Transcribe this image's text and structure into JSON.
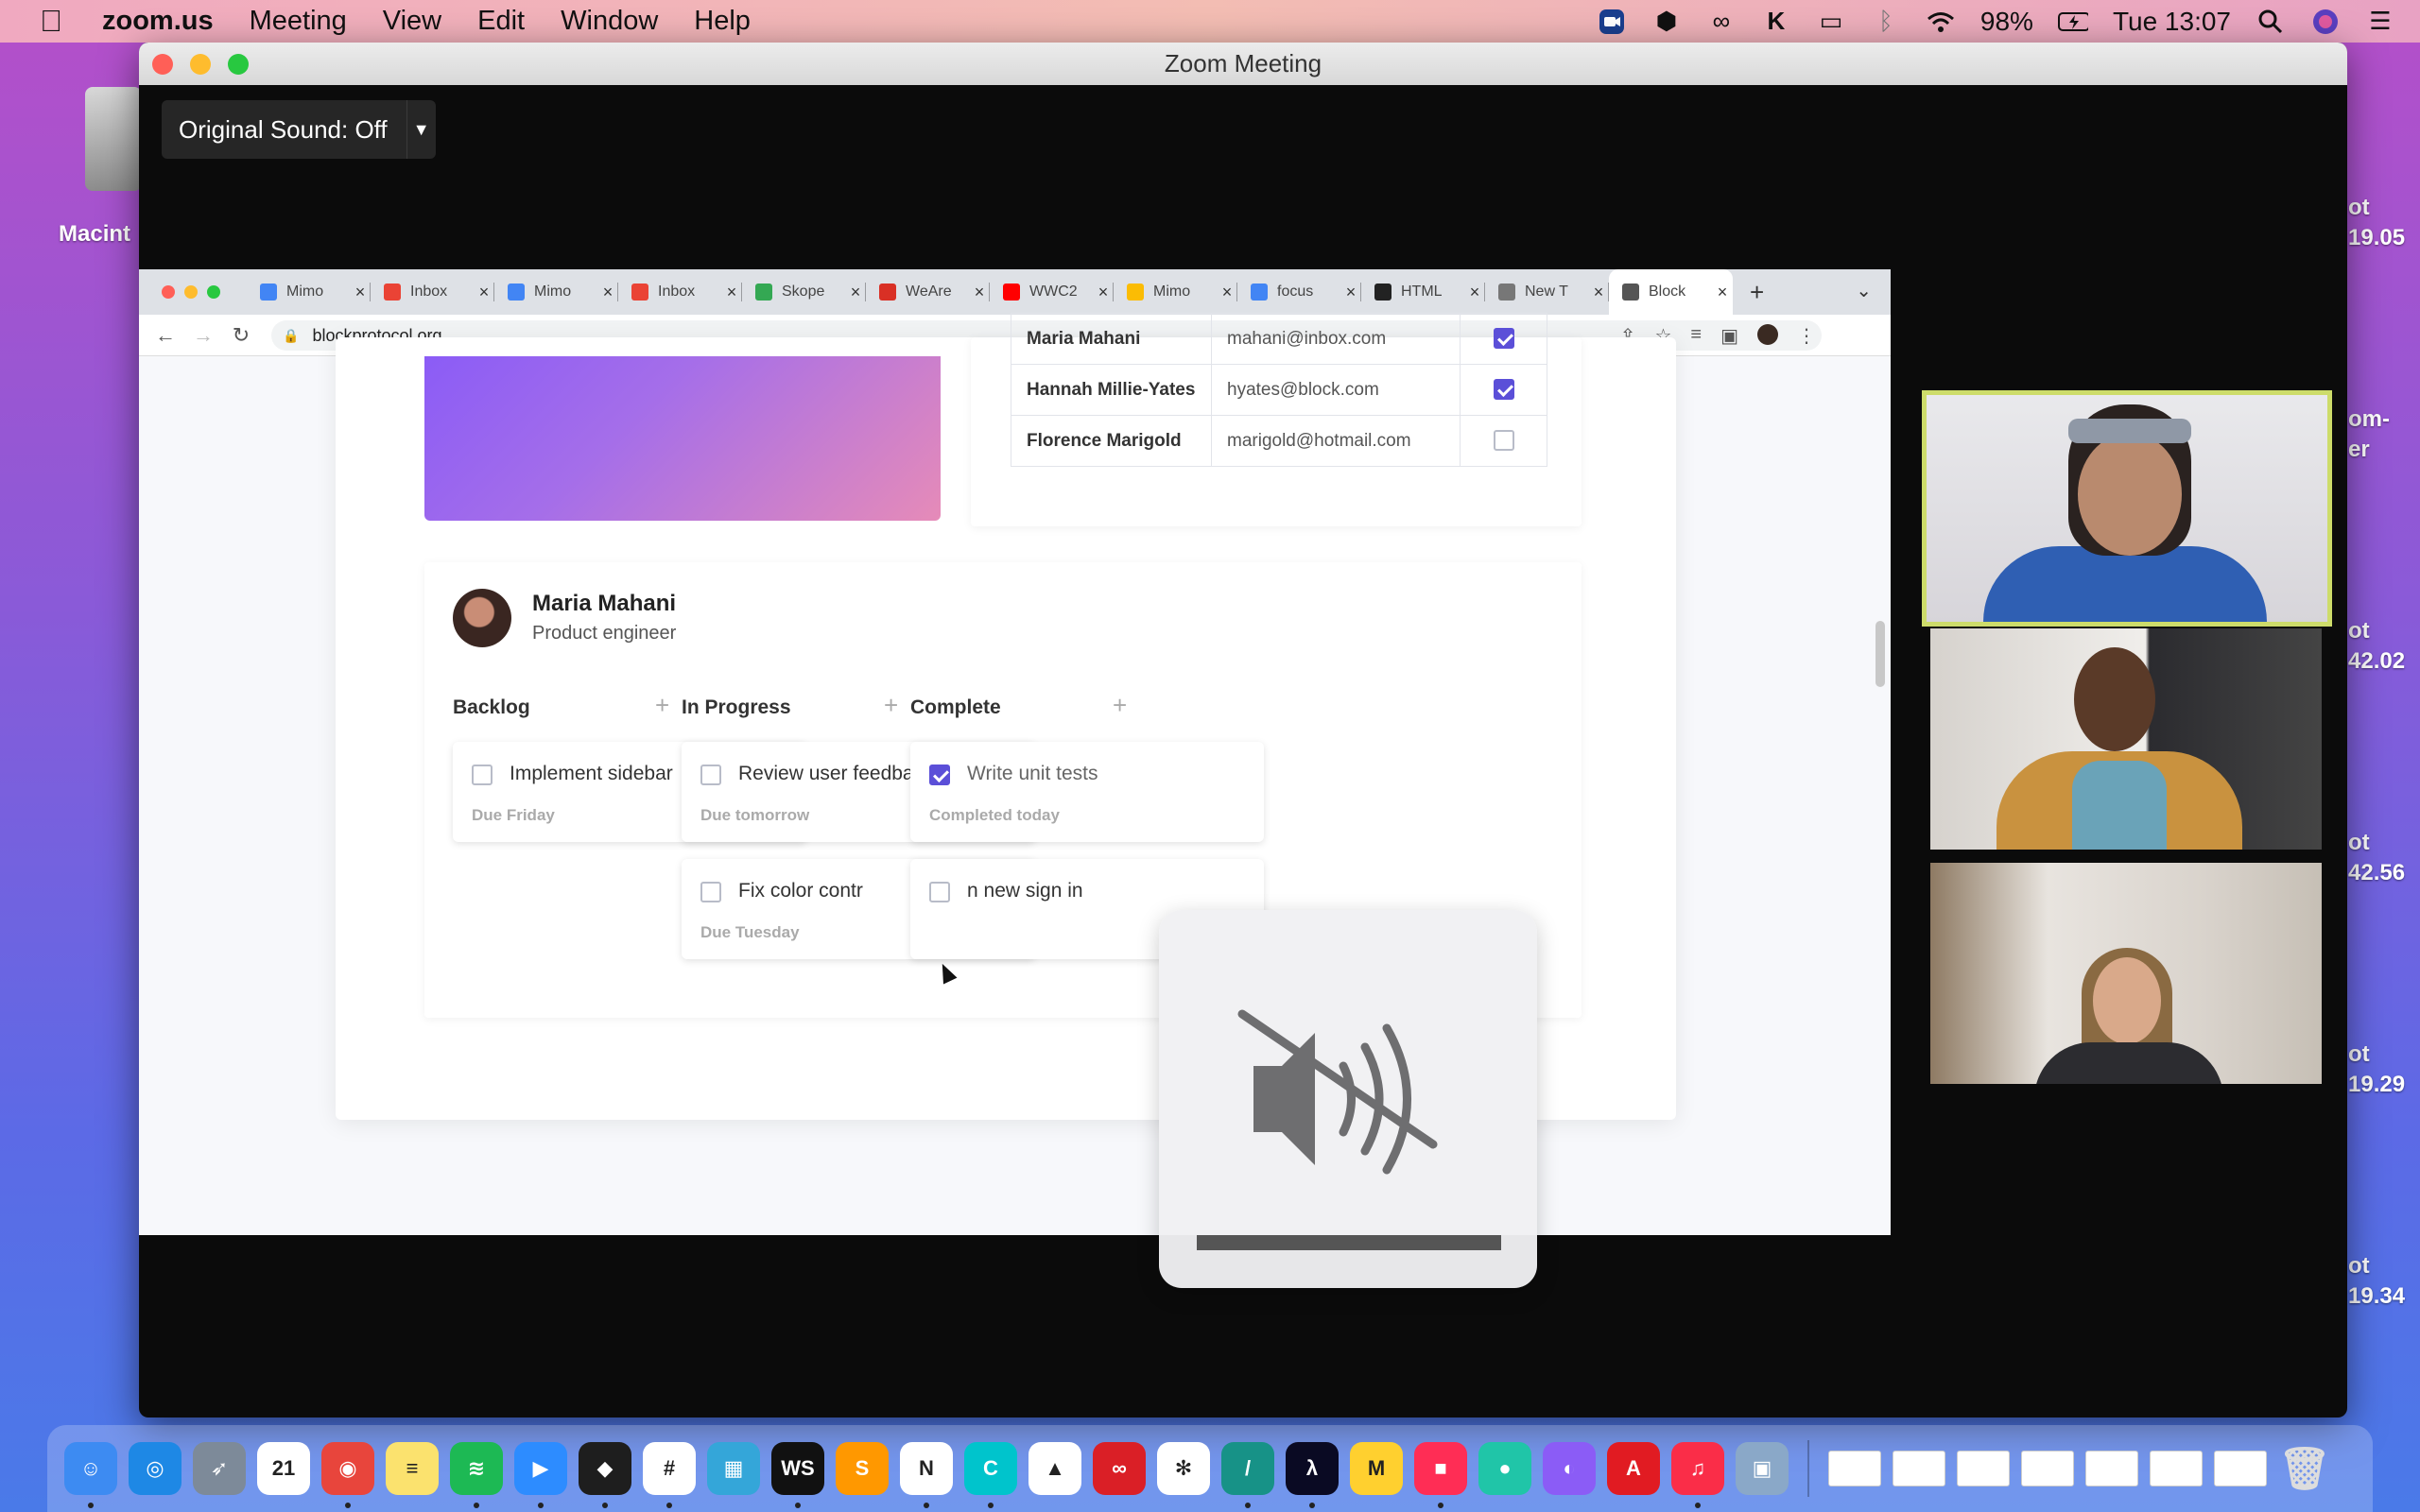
{
  "menubar": {
    "app_name": "zoom.us",
    "items": [
      "Meeting",
      "View",
      "Edit",
      "Window",
      "Help"
    ],
    "battery": "98%",
    "clock": "Tue 13:07"
  },
  "desktop": {
    "disk_label": "Macint",
    "right_labels": [
      "ot",
      "19.05",
      "om-",
      "er",
      "ot",
      "42.02",
      "ot",
      "42.56",
      "ot",
      "19.29",
      "ot",
      "19.34"
    ]
  },
  "zoom": {
    "window_title": "Zoom Meeting",
    "original_sound": "Original Sound: Off"
  },
  "browser": {
    "tabs": [
      {
        "label": "Mimo",
        "color": "#4285f4"
      },
      {
        "label": "Inbox",
        "color": "#ea4335"
      },
      {
        "label": "Mimo",
        "color": "#4285f4"
      },
      {
        "label": "Inbox",
        "color": "#ea4335"
      },
      {
        "label": "Skope",
        "color": "#34a853"
      },
      {
        "label": "WeAre",
        "color": "#d93025"
      },
      {
        "label": "WWC2",
        "color": "#ff0000"
      },
      {
        "label": "Mimo",
        "color": "#fbbc04"
      },
      {
        "label": "focus",
        "color": "#4285f4"
      },
      {
        "label": "HTML",
        "color": "#222222"
      },
      {
        "label": "New T",
        "color": "#777777"
      },
      {
        "label": "Block",
        "color": "#555555"
      }
    ],
    "url": "blockprotocol.org"
  },
  "table": {
    "rows": [
      {
        "name": "Maria Mahani",
        "email": "mahani@inbox.com",
        "checked": true
      },
      {
        "name": "Hannah Millie-Yates",
        "email": "hyates@block.com",
        "checked": true
      },
      {
        "name": "Florence Marigold",
        "email": "marigold@hotmail.com",
        "checked": false
      }
    ]
  },
  "profile": {
    "name": "Maria Mahani",
    "role": "Product engineer"
  },
  "kanban": {
    "columns": [
      {
        "title": "Backlog",
        "tasks": [
          {
            "name": "Implement sidebar",
            "due": "Due Friday",
            "done": false
          }
        ]
      },
      {
        "title": "In Progress",
        "tasks": [
          {
            "name": "Review user feedback",
            "due": "Due tomorrow",
            "done": false
          },
          {
            "name": "Fix color contr",
            "due": "Due Tuesday",
            "done": false
          }
        ]
      },
      {
        "title": "Complete",
        "tasks": [
          {
            "name": "Write unit tests",
            "due": "Completed today",
            "done": true
          },
          {
            "name": "n new sign in",
            "due": "",
            "done": false
          }
        ]
      }
    ]
  },
  "hud": {
    "icon": "speaker-muted-icon"
  },
  "colors": {
    "accent": "#5b4fd8",
    "active_speaker": "#cddc6a"
  },
  "dock": {
    "apps": [
      {
        "name": "finder",
        "color": "#3d8bf2",
        "glyph": "☺"
      },
      {
        "name": "safari",
        "color": "#1e88e5",
        "glyph": "◎"
      },
      {
        "name": "launchpad",
        "color": "#7d8a99",
        "glyph": "➶"
      },
      {
        "name": "calendar",
        "color": "#ffffff",
        "glyph": "21"
      },
      {
        "name": "chrome",
        "color": "#e8453c",
        "glyph": "◉"
      },
      {
        "name": "notes",
        "color": "#fbe26e",
        "glyph": "≡"
      },
      {
        "name": "spotify",
        "color": "#1db954",
        "glyph": "≋"
      },
      {
        "name": "zoom",
        "color": "#2d8cff",
        "glyph": "▶"
      },
      {
        "name": "figma",
        "color": "#1e1e1e",
        "glyph": "◆"
      },
      {
        "name": "slack",
        "color": "#ffffff",
        "glyph": "#"
      },
      {
        "name": "preview",
        "color": "#34a6d9",
        "glyph": "▦"
      },
      {
        "name": "webstorm",
        "color": "#111111",
        "glyph": "WS"
      },
      {
        "name": "sublime",
        "color": "#ff9800",
        "glyph": "S"
      },
      {
        "name": "notion",
        "color": "#ffffff",
        "glyph": "N"
      },
      {
        "name": "canva",
        "color": "#00c4cc",
        "glyph": "C"
      },
      {
        "name": "google-drive",
        "color": "#ffffff",
        "glyph": "▲"
      },
      {
        "name": "creative-cloud",
        "color": "#da1f26",
        "glyph": "∞"
      },
      {
        "name": "settings-flower",
        "color": "#ffffff",
        "glyph": "✻"
      },
      {
        "name": "gitkraken",
        "color": "#179287",
        "glyph": "/"
      },
      {
        "name": "freecodecamp",
        "color": "#0a0a23",
        "glyph": "λ"
      },
      {
        "name": "miro",
        "color": "#ffd02f",
        "glyph": "M"
      },
      {
        "name": "screen-rec",
        "color": "#ff2d55",
        "glyph": "■"
      },
      {
        "name": "twist",
        "color": "#20c5a8",
        "glyph": "●"
      },
      {
        "name": "github",
        "color": "#8b5cf6",
        "glyph": "◐"
      },
      {
        "name": "acrobat",
        "color": "#e11b22",
        "glyph": "A"
      },
      {
        "name": "music",
        "color": "#fa2d48",
        "glyph": "♫"
      },
      {
        "name": "image-capture",
        "color": "#8aa8c8",
        "glyph": "▣"
      }
    ],
    "window_count": 7
  }
}
